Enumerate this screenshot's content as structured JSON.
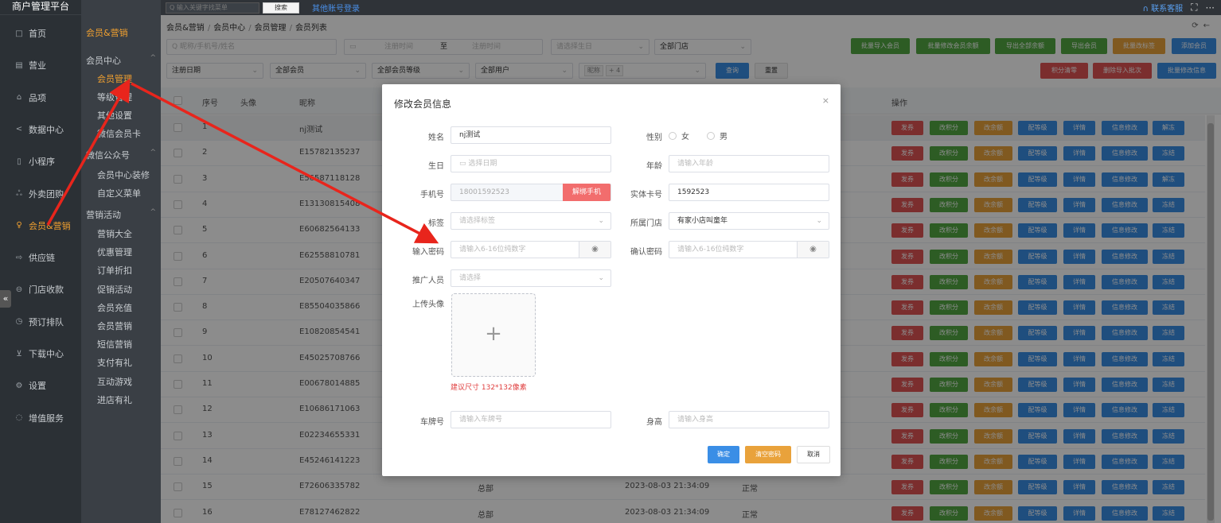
{
  "app_title": "商户管理平台",
  "topbar": {
    "search_placeholder": "输入关键字找菜单",
    "search_button": "搜索",
    "other_login": "其他账号登录",
    "contact": "联系客服"
  },
  "sidebar": {
    "items": [
      {
        "label": "首页",
        "icon": "□"
      },
      {
        "label": "营业",
        "icon": "▤"
      },
      {
        "label": "品项",
        "icon": "⌂"
      },
      {
        "label": "数据中心",
        "icon": "<"
      },
      {
        "label": "小程序",
        "icon": "▯"
      },
      {
        "label": "外卖团购",
        "icon": "ஃ"
      },
      {
        "label": "会员&营销",
        "icon": "♀"
      },
      {
        "label": "供应链",
        "icon": "⇨"
      },
      {
        "label": "门店收款",
        "icon": "⊖"
      },
      {
        "label": "预订排队",
        "icon": "◷"
      },
      {
        "label": "下载中心",
        "icon": "⊻"
      },
      {
        "label": "设置",
        "icon": "⚙"
      },
      {
        "label": "增值服务",
        "icon": "◌"
      }
    ]
  },
  "subnav": {
    "header": "会员&营销",
    "group1": "会员中心",
    "group1_items": [
      "会员管理",
      "等级管理",
      "其他设置",
      "微信会员卡"
    ],
    "group2": "微信公众号",
    "group2_items": [
      "会员中心装修",
      "自定义菜单"
    ],
    "group3": "营销活动",
    "group3_items": [
      "营销大全",
      "优惠管理",
      "订单折扣",
      "促销活动",
      "会员充值",
      "会员营销",
      "短信营销",
      "支付有礼",
      "互动游戏",
      "进店有礼"
    ]
  },
  "breadcrumb": [
    "会员&营销",
    "会员中心",
    "会员管理",
    "会员列表"
  ],
  "filters": {
    "search_placeholder": "昵称/手机号/姓名",
    "reg_start_placeholder": "注册时间",
    "to_label": "至",
    "reg_end_placeholder": "注册时间",
    "birthday_placeholder": "请选择生日",
    "store_select": "全部门店",
    "sort_select": "注册日期",
    "member_select": "全部会员",
    "level_select": "全部会员等级",
    "user_select": "全部用户",
    "tag1": "昵称",
    "tag2": "+ 4",
    "query_button": "查询",
    "reset_button": "重置"
  },
  "actions": {
    "batch_import": "批量导入会员",
    "batch_balance": "批量修改会员余额",
    "export_balance": "导出全部余额",
    "export_members": "导出会员",
    "batch_tags": "批量改标签",
    "add_member": "添加会员",
    "clear_points": "积分清零",
    "delete_batch": "删除导入批次",
    "batch_info": "批量修改信息"
  },
  "table": {
    "headers": [
      "序号",
      "头像",
      "昵称",
      "操作"
    ],
    "rows": [
      {
        "no": "1",
        "nick": "nj测试",
        "store": "",
        "time": "",
        "status": "",
        "freeze": "解冻"
      },
      {
        "no": "2",
        "nick": "E15782135237",
        "store": "",
        "time": "",
        "status": "",
        "freeze": "冻结"
      },
      {
        "no": "3",
        "nick": "E56587118128",
        "store": "",
        "time": "",
        "status": "",
        "freeze": "解冻"
      },
      {
        "no": "4",
        "nick": "E13130815408",
        "store": "",
        "time": "",
        "status": "",
        "freeze": "冻结"
      },
      {
        "no": "5",
        "nick": "E60682564133",
        "store": "",
        "time": "",
        "status": "",
        "freeze": "冻结"
      },
      {
        "no": "6",
        "nick": "E62558810781",
        "store": "",
        "time": "",
        "status": "",
        "freeze": "冻结"
      },
      {
        "no": "7",
        "nick": "E20507640347",
        "store": "",
        "time": "",
        "status": "",
        "freeze": "冻结"
      },
      {
        "no": "8",
        "nick": "E85504035866",
        "store": "",
        "time": "",
        "status": "",
        "freeze": "冻结"
      },
      {
        "no": "9",
        "nick": "E10820854541",
        "store": "",
        "time": "",
        "status": "",
        "freeze": "冻结"
      },
      {
        "no": "10",
        "nick": "E45025708766",
        "store": "",
        "time": "",
        "status": "",
        "freeze": "冻结"
      },
      {
        "no": "11",
        "nick": "E00678014885",
        "store": "",
        "time": "",
        "status": "",
        "freeze": "冻结"
      },
      {
        "no": "12",
        "nick": "E10686171063",
        "store": "",
        "time": "",
        "status": "",
        "freeze": "冻结"
      },
      {
        "no": "13",
        "nick": "E02234655331",
        "store": "",
        "time": "",
        "status": "",
        "freeze": "冻结"
      },
      {
        "no": "14",
        "nick": "E45246141223",
        "store": "",
        "time": "",
        "status": "",
        "freeze": "冻结"
      },
      {
        "no": "15",
        "nick": "E72606335782",
        "store": "总部",
        "time": "2023-08-03 21:34:09",
        "status": "正常",
        "freeze": "冻结"
      },
      {
        "no": "16",
        "nick": "E78127462822",
        "store": "总部",
        "time": "2023-08-03 21:34:09",
        "status": "正常",
        "freeze": "冻结"
      }
    ],
    "row_buttons": [
      "发券",
      "改积分",
      "改余额",
      "配等级",
      "详情",
      "信息修改"
    ]
  },
  "modal": {
    "title": "修改会员信息",
    "name_label": "姓名",
    "name_value": "nj测试",
    "gender_label": "性别",
    "female": "女",
    "male": "男",
    "birthday_label": "生日",
    "birthday_placeholder": "选择日期",
    "age_label": "年龄",
    "age_placeholder": "请输入年龄",
    "phone_label": "手机号",
    "phone_value": "18001592523",
    "unbind_button": "解绑手机",
    "card_label": "实体卡号",
    "card_value": "1592523",
    "tag_label": "标签",
    "tag_placeholder": "请选择标签",
    "store_label": "所属门店",
    "store_value": "有家小店叫童年",
    "pwd_label": "输入密码",
    "pwd_placeholder": "请输入6-16位纯数字",
    "confirm_pwd_label": "确认密码",
    "confirm_pwd_placeholder": "请输入6-16位纯数字",
    "promoter_label": "推广人员",
    "promoter_placeholder": "请选择",
    "avatar_label": "上传头像",
    "avatar_hint": "建议尺寸 132*132像素",
    "plate_label": "车牌号",
    "plate_placeholder": "请输入车牌号",
    "height_label": "身高",
    "height_placeholder": "请输入身高",
    "ok_button": "确定",
    "clear_pwd_button": "清空密码",
    "cancel_button": "取消"
  },
  "colors": {
    "accent": "#f0a030",
    "danger": "#e05555",
    "success": "#52a843",
    "primary": "#3a8ee6",
    "annotation_arrow": "#e8251c"
  }
}
